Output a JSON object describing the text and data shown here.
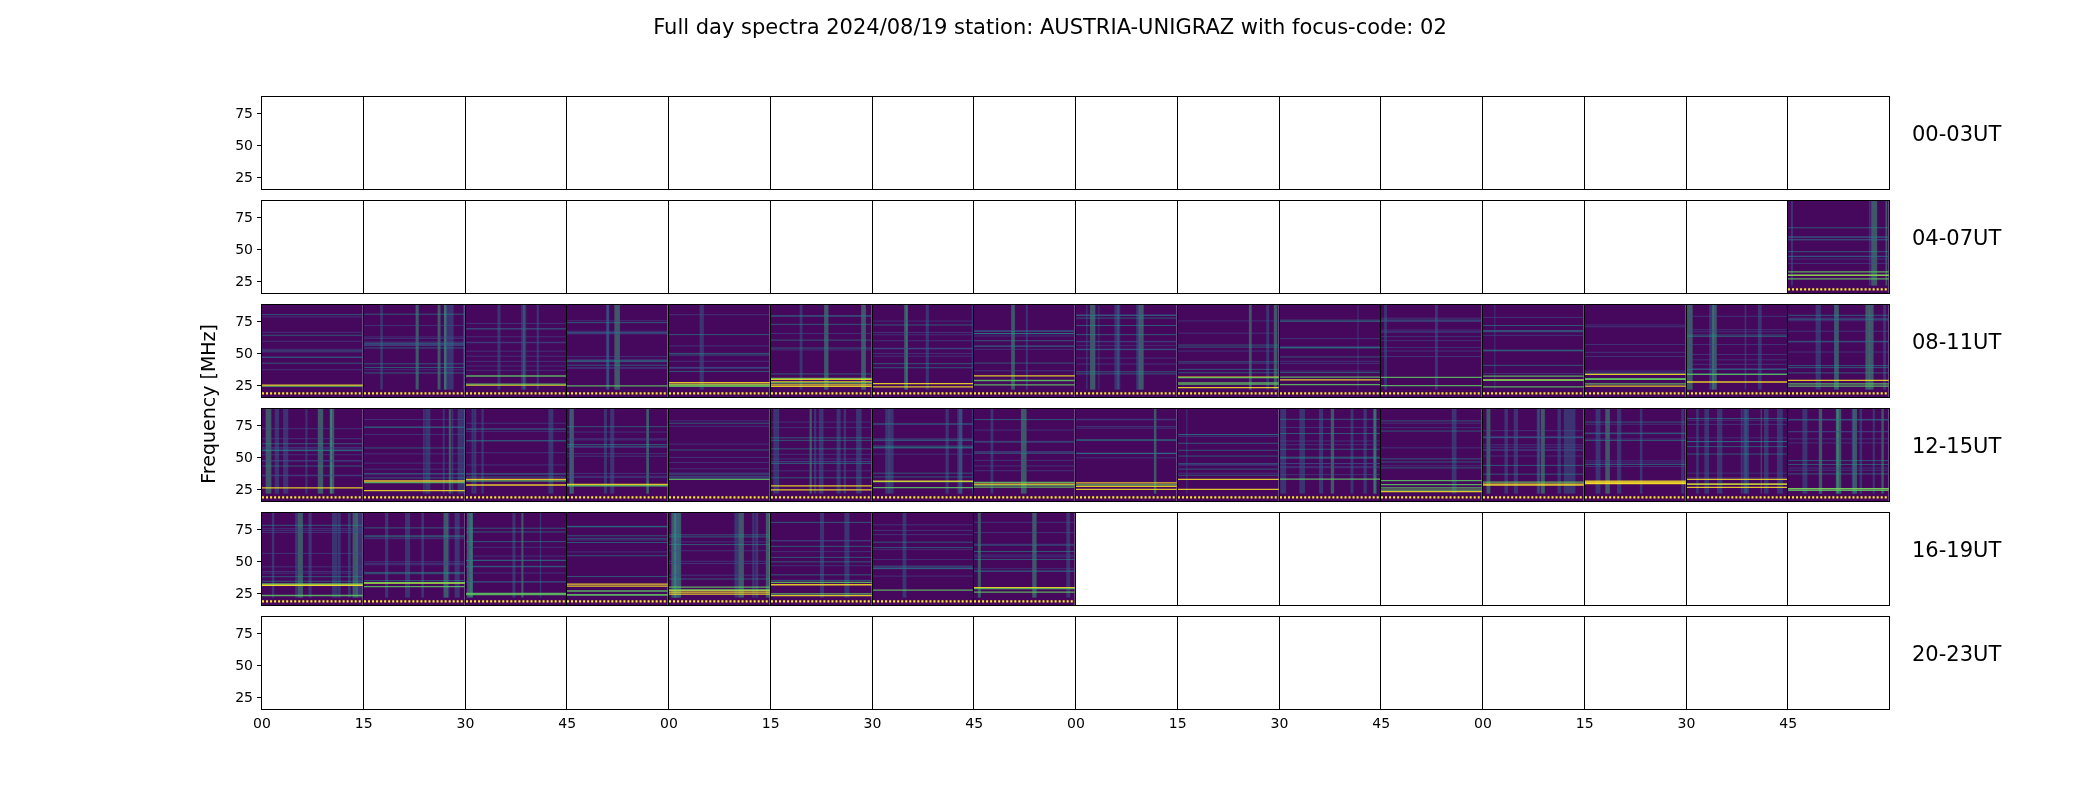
{
  "title": "Full day spectra 2024/08/19 station: AUSTRIA-UNIGRAZ with focus-code: 02",
  "ylabel": "Frequency [MHz]",
  "rows": [
    {
      "label": "00-03UT",
      "y_ticks": [
        "75",
        "50",
        "25"
      ],
      "panels": [
        {
          "has_data": false
        },
        {
          "has_data": false
        },
        {
          "has_data": false
        },
        {
          "has_data": false
        },
        {
          "has_data": false
        },
        {
          "has_data": false
        },
        {
          "has_data": false
        },
        {
          "has_data": false
        },
        {
          "has_data": false
        },
        {
          "has_data": false
        },
        {
          "has_data": false
        },
        {
          "has_data": false
        },
        {
          "has_data": false
        },
        {
          "has_data": false
        },
        {
          "has_data": false
        },
        {
          "has_data": false
        }
      ]
    },
    {
      "label": "04-07UT",
      "y_ticks": [
        "75",
        "50",
        "25"
      ],
      "panels": [
        {
          "has_data": false
        },
        {
          "has_data": false
        },
        {
          "has_data": false
        },
        {
          "has_data": false
        },
        {
          "has_data": false
        },
        {
          "has_data": false
        },
        {
          "has_data": false
        },
        {
          "has_data": false
        },
        {
          "has_data": false
        },
        {
          "has_data": false
        },
        {
          "has_data": false
        },
        {
          "has_data": false
        },
        {
          "has_data": false
        },
        {
          "has_data": false
        },
        {
          "has_data": false
        },
        {
          "has_data": true
        }
      ]
    },
    {
      "label": "08-11UT",
      "y_ticks": [
        "75",
        "50",
        "25"
      ],
      "panels": [
        {
          "has_data": true
        },
        {
          "has_data": true
        },
        {
          "has_data": true
        },
        {
          "has_data": true
        },
        {
          "has_data": true
        },
        {
          "has_data": true
        },
        {
          "has_data": true
        },
        {
          "has_data": true
        },
        {
          "has_data": true
        },
        {
          "has_data": true
        },
        {
          "has_data": true
        },
        {
          "has_data": true
        },
        {
          "has_data": true
        },
        {
          "has_data": true
        },
        {
          "has_data": true
        },
        {
          "has_data": true
        }
      ]
    },
    {
      "label": "12-15UT",
      "y_ticks": [
        "75",
        "50",
        "25"
      ],
      "panels": [
        {
          "has_data": true
        },
        {
          "has_data": true
        },
        {
          "has_data": true
        },
        {
          "has_data": true
        },
        {
          "has_data": true
        },
        {
          "has_data": true
        },
        {
          "has_data": true
        },
        {
          "has_data": true
        },
        {
          "has_data": true
        },
        {
          "has_data": true
        },
        {
          "has_data": true
        },
        {
          "has_data": true
        },
        {
          "has_data": true
        },
        {
          "has_data": true
        },
        {
          "has_data": true
        },
        {
          "has_data": true
        }
      ]
    },
    {
      "label": "16-19UT",
      "y_ticks": [
        "75",
        "50",
        "25"
      ],
      "panels": [
        {
          "has_data": true
        },
        {
          "has_data": true
        },
        {
          "has_data": true
        },
        {
          "has_data": true
        },
        {
          "has_data": true
        },
        {
          "has_data": true
        },
        {
          "has_data": true
        },
        {
          "has_data": true
        },
        {
          "has_data": false
        },
        {
          "has_data": false
        },
        {
          "has_data": false
        },
        {
          "has_data": false
        },
        {
          "has_data": false
        },
        {
          "has_data": false
        },
        {
          "has_data": false
        },
        {
          "has_data": false
        }
      ]
    },
    {
      "label": "20-23UT",
      "y_ticks": [
        "75",
        "50",
        "25"
      ],
      "panels": [
        {
          "has_data": false
        },
        {
          "has_data": false
        },
        {
          "has_data": false
        },
        {
          "has_data": false
        },
        {
          "has_data": false
        },
        {
          "has_data": false
        },
        {
          "has_data": false
        },
        {
          "has_data": false
        },
        {
          "has_data": false
        },
        {
          "has_data": false
        },
        {
          "has_data": false
        },
        {
          "has_data": false
        },
        {
          "has_data": false
        },
        {
          "has_data": false
        },
        {
          "has_data": false
        },
        {
          "has_data": false
        }
      ]
    }
  ],
  "x_ticks": [
    "00",
    "15",
    "30",
    "45",
    "00",
    "15",
    "30",
    "45",
    "00",
    "15",
    "30",
    "45",
    "00",
    "15",
    "30",
    "45"
  ]
}
